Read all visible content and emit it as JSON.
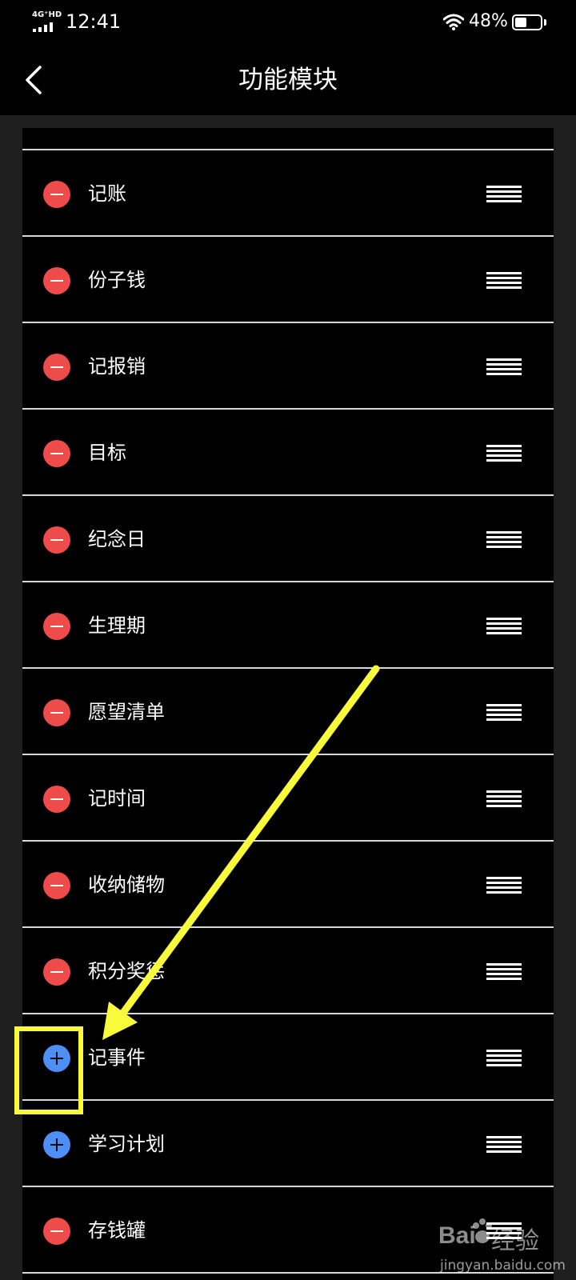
{
  "status_bar": {
    "network": "4G⁺HD",
    "time": "12:41",
    "battery_percent": "48%",
    "battery_level": 0.48
  },
  "nav": {
    "title": "功能模块",
    "back_icon": "chevron-left-icon"
  },
  "modules": [
    {
      "label": "记账",
      "state": "remove"
    },
    {
      "label": "份子钱",
      "state": "remove"
    },
    {
      "label": "记报销",
      "state": "remove"
    },
    {
      "label": "目标",
      "state": "remove"
    },
    {
      "label": "纪念日",
      "state": "remove"
    },
    {
      "label": "生理期",
      "state": "remove"
    },
    {
      "label": "愿望清单",
      "state": "remove"
    },
    {
      "label": "记时间",
      "state": "remove"
    },
    {
      "label": "收纳储物",
      "state": "remove"
    },
    {
      "label": "积分奖惩",
      "state": "remove"
    },
    {
      "label": "记事件",
      "state": "add"
    },
    {
      "label": "学习计划",
      "state": "add"
    },
    {
      "label": "存钱罐",
      "state": "remove"
    }
  ],
  "colors": {
    "remove": "#ee4b4b",
    "add": "#4e8ff5",
    "annotation": "#fafa3c",
    "background": "#000000",
    "gutter": "#1e1e1e",
    "divider": "#d8d8d8"
  },
  "watermark": {
    "brand": "Bai",
    "brand_cn": "经验",
    "url": "jingyan.baidu.com"
  }
}
